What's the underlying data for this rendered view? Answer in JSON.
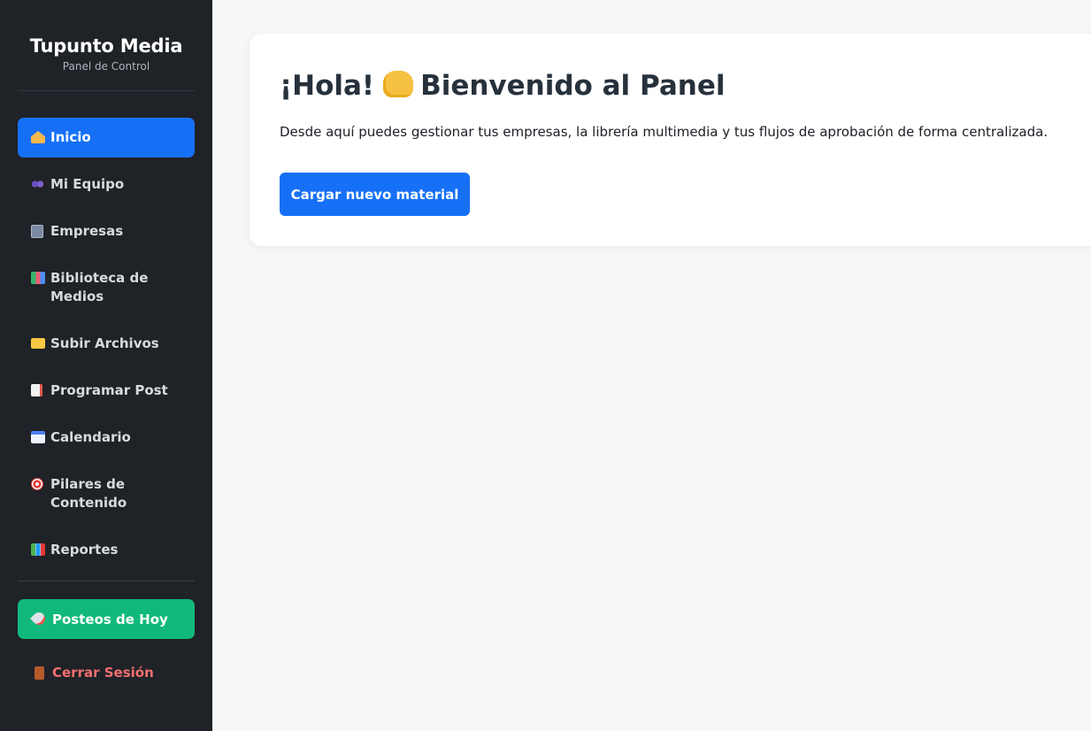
{
  "brand": {
    "title": "Tupunto Media",
    "subtitle": "Panel de Control"
  },
  "sidebar": {
    "items": [
      {
        "label": "Inicio",
        "icon": "house-icon",
        "active": true
      },
      {
        "label": "Mi Equipo",
        "icon": "team-icon"
      },
      {
        "label": "Empresas",
        "icon": "building-icon"
      },
      {
        "label": "Biblioteca de Medios",
        "icon": "books-icon"
      },
      {
        "label": "Subir Archivos",
        "icon": "folder-icon"
      },
      {
        "label": "Programar Post",
        "icon": "page-icon"
      },
      {
        "label": "Calendario",
        "icon": "calendar-icon"
      },
      {
        "label": "Pilares de Contenido",
        "icon": "target-icon"
      },
      {
        "label": "Reportes",
        "icon": "bar-chart-icon"
      }
    ],
    "today_posts": {
      "label": "Posteos de Hoy",
      "icon": "rocket-icon"
    },
    "logout": {
      "label": "Cerrar Sesión",
      "icon": "door-icon"
    }
  },
  "main": {
    "greeting": "¡Hola!",
    "greeting_icon": "waving-hand-icon",
    "title_rest": "Bienvenido al Panel",
    "description": "Desde aquí puedes gestionar tus empresas, la librería multimedia y tus flujos de aprobación de forma centralizada.",
    "cta_label": "Cargar nuevo material"
  },
  "colors": {
    "sidebar_bg": "#1f2227",
    "primary": "#1670f6",
    "success": "#10b97b",
    "danger_text": "#f16f6f",
    "page_bg": "#f6f7f9"
  }
}
